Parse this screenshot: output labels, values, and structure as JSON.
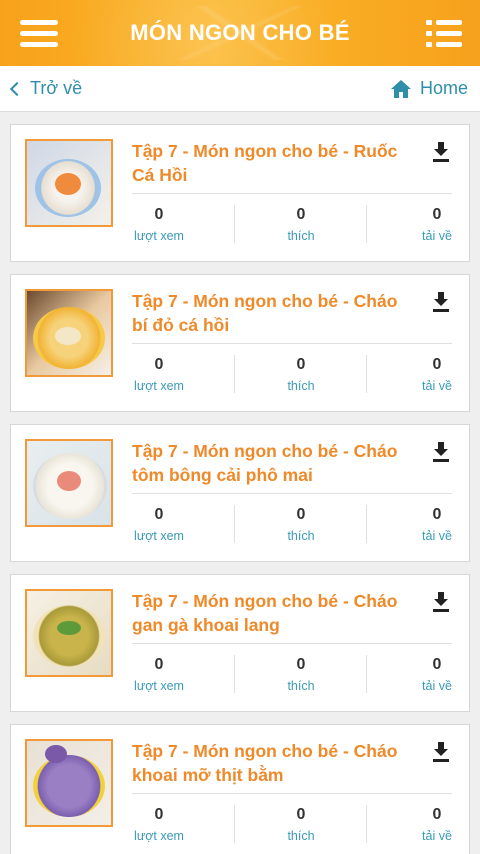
{
  "header": {
    "title": "MÓN NGON CHO BÉ",
    "menu_icon": "hamburger-menu-icon",
    "list_icon": "list-view-icon"
  },
  "nav": {
    "back_label": "Trở về",
    "home_label": "Home"
  },
  "colors": {
    "accent": "#f8a21a",
    "title_orange": "#ee8a2a",
    "link_blue": "#2f8ea8"
  },
  "labels": {
    "views": "lượt xem",
    "likes": "thích",
    "downloads": "tải về"
  },
  "items": [
    {
      "title": "Tập 7 - Món ngon cho bé - Ruốc Cá Hồi",
      "views": "0",
      "likes": "0",
      "downloads": "0"
    },
    {
      "title": "Tập 7 - Món ngon cho bé - Cháo bí đỏ cá hồi",
      "views": "0",
      "likes": "0",
      "downloads": "0"
    },
    {
      "title": "Tập 7 - Món ngon cho bé - Cháo tôm bông cải phô mai",
      "views": "0",
      "likes": "0",
      "downloads": "0"
    },
    {
      "title": "Tập 7 - Món ngon cho bé - Cháo gan gà khoai lang",
      "views": "0",
      "likes": "0",
      "downloads": "0"
    },
    {
      "title": "Tập 7 - Món ngon cho bé - Cháo khoai mỡ thịt bằm",
      "views": "0",
      "likes": "0",
      "downloads": "0"
    }
  ]
}
